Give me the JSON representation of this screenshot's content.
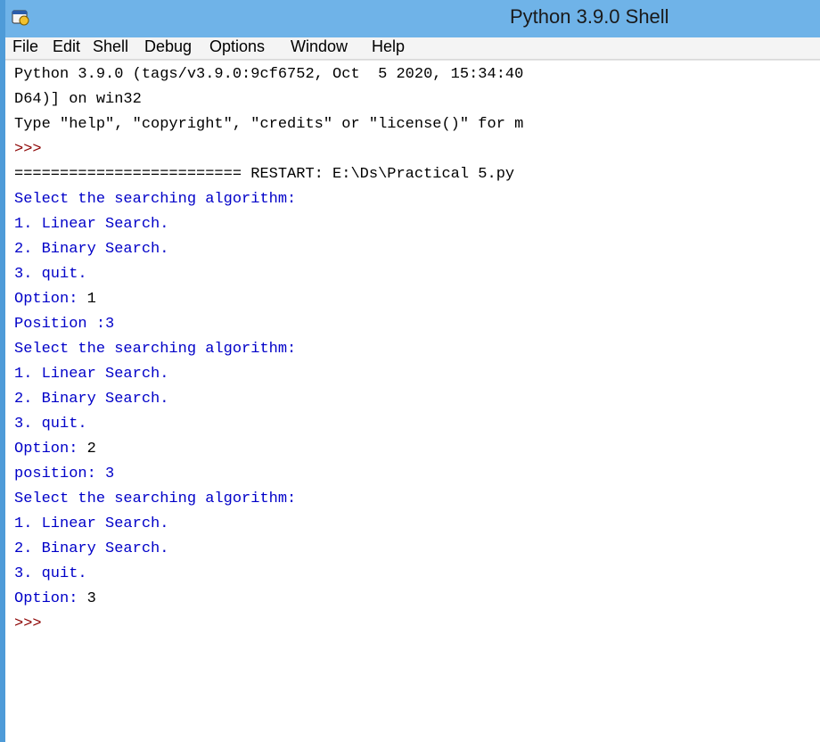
{
  "window": {
    "title": "Python 3.9.0 Shell"
  },
  "menu": [
    "File",
    "Edit",
    "Shell",
    "Debug",
    "Options",
    "Window",
    "Help"
  ],
  "shell_lines": [
    {
      "text": "Python 3.9.0 (tags/v3.9.0:9cf6752, Oct  5 2020, 15:34:40",
      "kind": "sys"
    },
    {
      "text": "D64)] on win32",
      "kind": "sys"
    },
    {
      "text": "Type \"help\", \"copyright\", \"credits\" or \"license()\" for m",
      "kind": "sys"
    },
    {
      "text": ">>>",
      "kind": "prompt"
    },
    {
      "text": "========================= RESTART: E:\\Ds\\Practical 5.py",
      "kind": "sys"
    },
    {
      "text": "Select the searching algorithm:",
      "kind": "out"
    },
    {
      "text": "1. Linear Search.",
      "kind": "out"
    },
    {
      "text": "2. Binary Search.",
      "kind": "out"
    },
    {
      "text": "3. quit.",
      "kind": "out"
    },
    {
      "text": "Option: ",
      "input": "1",
      "kind": "out"
    },
    {
      "text": "Position :3",
      "kind": "out"
    },
    {
      "text": "Select the searching algorithm:",
      "kind": "out"
    },
    {
      "text": "1. Linear Search.",
      "kind": "out"
    },
    {
      "text": "2. Binary Search.",
      "kind": "out"
    },
    {
      "text": "3. quit.",
      "kind": "out"
    },
    {
      "text": "Option: ",
      "input": "2",
      "kind": "out"
    },
    {
      "text": "position: 3",
      "kind": "out"
    },
    {
      "text": "Select the searching algorithm:",
      "kind": "out"
    },
    {
      "text": "1. Linear Search.",
      "kind": "out"
    },
    {
      "text": "2. Binary Search.",
      "kind": "out"
    },
    {
      "text": "3. quit.",
      "kind": "out"
    },
    {
      "text": "Option: ",
      "input": "3",
      "kind": "out"
    },
    {
      "text": ">>>",
      "kind": "prompt"
    }
  ]
}
